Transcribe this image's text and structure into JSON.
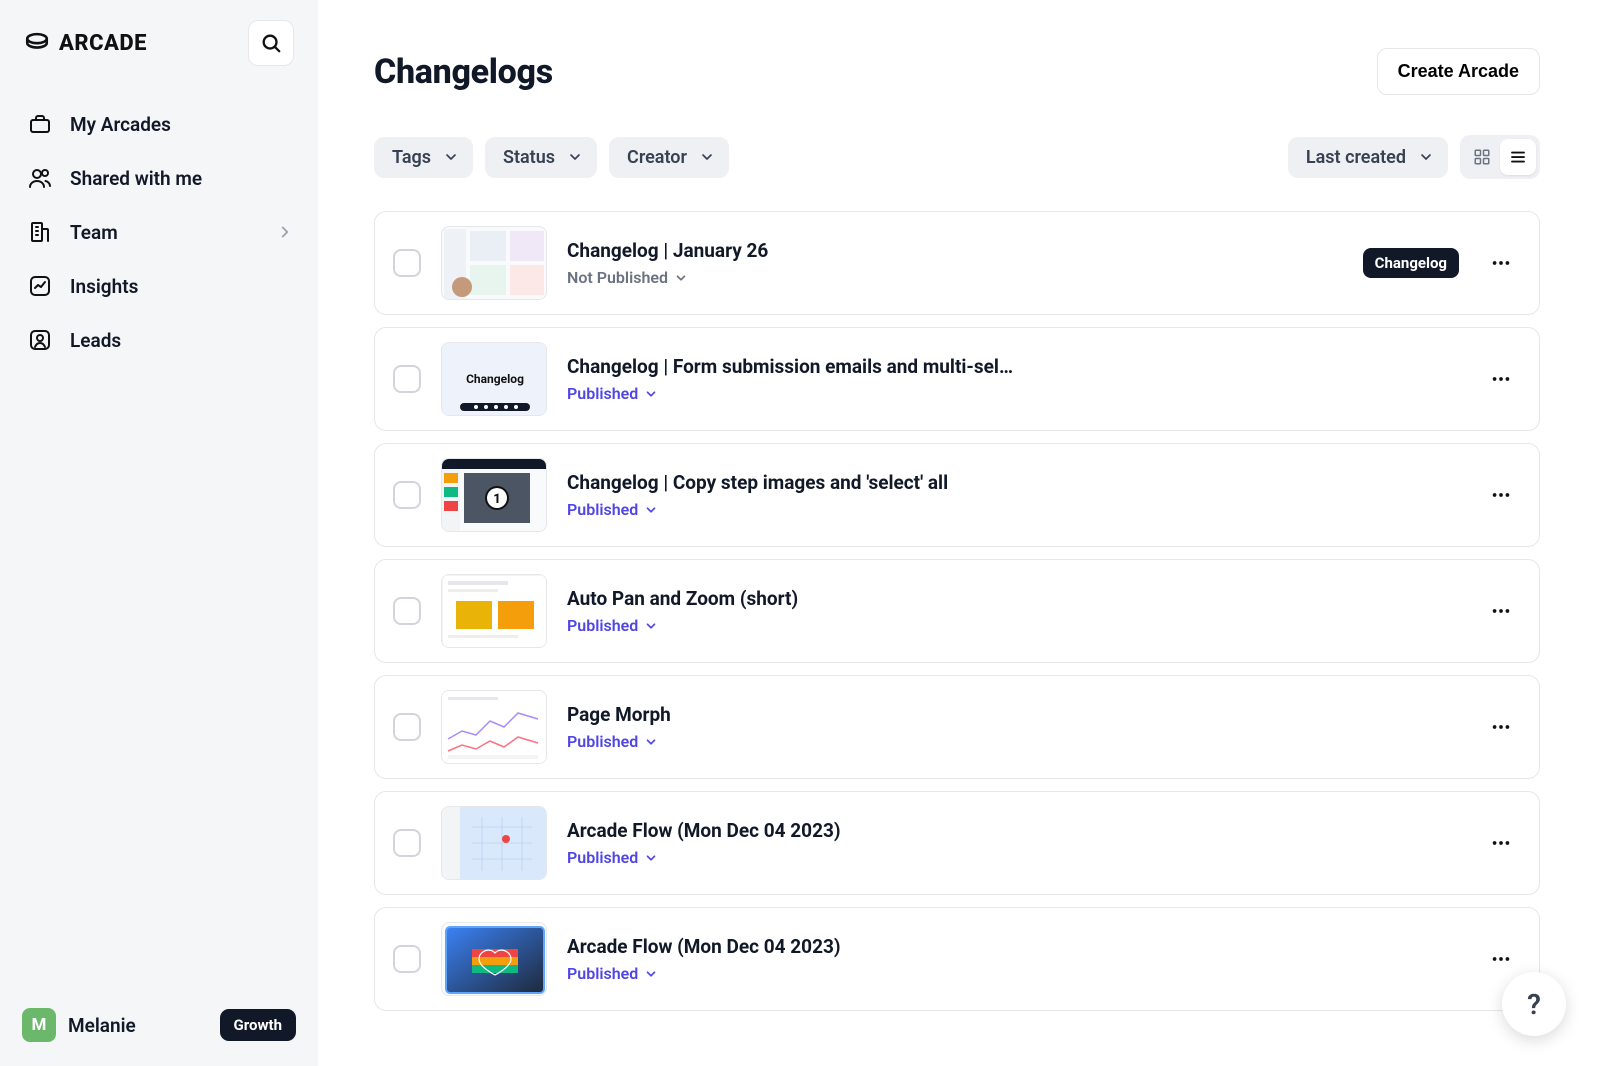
{
  "brand": {
    "name": "ARCADE"
  },
  "sidebar": {
    "items": [
      {
        "id": "my-arcades",
        "label": "My Arcades"
      },
      {
        "id": "shared",
        "label": "Shared with me"
      },
      {
        "id": "team",
        "label": "Team"
      },
      {
        "id": "insights",
        "label": "Insights"
      },
      {
        "id": "leads",
        "label": "Leads"
      }
    ],
    "user": {
      "initial": "M",
      "name": "Melanie",
      "plan": "Growth"
    }
  },
  "main": {
    "title": "Changelogs",
    "create_label": "Create Arcade",
    "filters": {
      "tags": "Tags",
      "status": "Status",
      "creator": "Creator"
    },
    "sort_label": "Last created",
    "rows": [
      {
        "title": "Changelog | January 26",
        "status": "Not Published",
        "status_kind": "not-published",
        "badge": "Changelog"
      },
      {
        "title": "Changelog | Form submission emails and multi-sel…",
        "status": "Published",
        "status_kind": "published"
      },
      {
        "title": "Changelog | Copy step images and 'select' all",
        "status": "Published",
        "status_kind": "published"
      },
      {
        "title": "Auto Pan and Zoom (short)",
        "status": "Published",
        "status_kind": "published"
      },
      {
        "title": "Page Morph",
        "status": "Published",
        "status_kind": "published"
      },
      {
        "title": "Arcade Flow (Mon Dec 04 2023)",
        "status": "Published",
        "status_kind": "published"
      },
      {
        "title": "Arcade Flow (Mon Dec 04 2023)",
        "status": "Published",
        "status_kind": "published"
      }
    ],
    "help_label": "?"
  }
}
